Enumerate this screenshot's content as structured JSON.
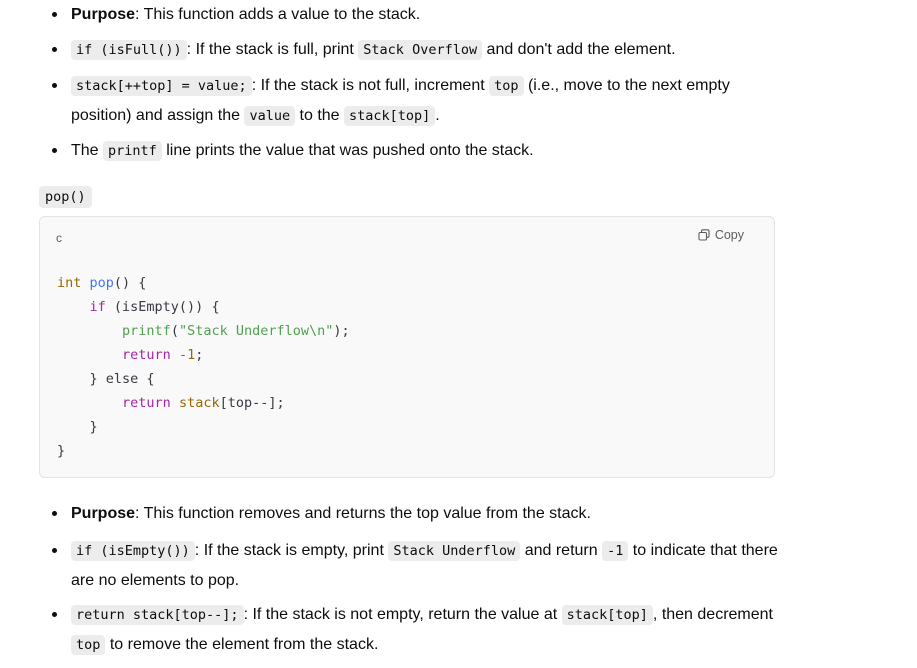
{
  "list1": [
    {
      "bold": "Purpose",
      "rest": ": This function adds a value to the stack."
    },
    {
      "code": "if (isFull())",
      "t1": ": If the stack is full, print ",
      "code2": "Stack Overflow",
      "t2": " and don't add the element."
    },
    {
      "code": "stack[++top] = value;",
      "t1": ": If the stack is not full, increment ",
      "code2": "top",
      "t2": " (i.e., move to the next empty position) and assign the ",
      "code3": "value",
      "t3": " to the ",
      "code4": "stack[top]",
      "t4": "."
    },
    {
      "t0": "The ",
      "code": "printf",
      "t1": " line prints the value that was pushed onto the stack."
    }
  ],
  "section_heading": "pop()",
  "codeblock": {
    "lang": "c",
    "copy_label": "Copy",
    "lines": {
      "l1_type": "int",
      "l1_fn": "pop",
      "l1_rest": "() {",
      "l2_kw": "if",
      "l2_rest": " (isEmpty()) {",
      "l3_fn": "printf",
      "l3_p": "(",
      "l3_str": "\"Stack Underflow\\n\"",
      "l3_end": ");",
      "l4_kw": "return",
      "l4_num": "-1",
      "l4_end": ";",
      "l5": "} else {",
      "l6_kw": "return",
      "l6_var": "stack",
      "l6_rest": "[top--];",
      "l7": "}",
      "l8": "}"
    }
  },
  "list2": [
    {
      "bold": "Purpose",
      "rest": ": This function removes and returns the top value from the stack."
    },
    {
      "code": "if (isEmpty())",
      "t1": ": If the stack is empty, print ",
      "code2": "Stack Underflow",
      "t2": " and return ",
      "code3": "-1",
      "t3": " to indicate that there are no elements to pop."
    },
    {
      "code": "return stack[top--];",
      "t1": ": If the stack is not empty, return the value at ",
      "code2": "stack[top]",
      "t2": ", then decrement ",
      "code3": "top",
      "t3": " to remove the element from the stack."
    }
  ]
}
